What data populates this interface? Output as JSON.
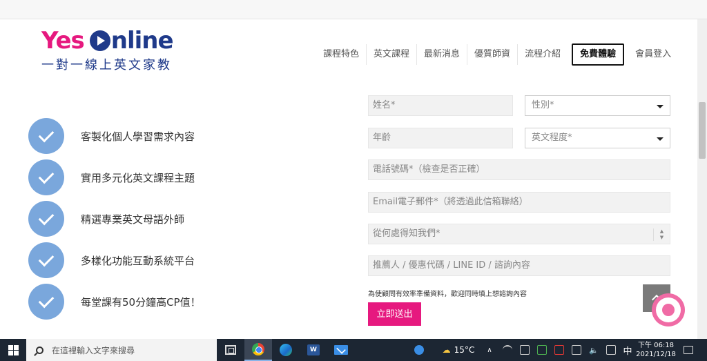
{
  "logo": {
    "brand_yes": "Yes",
    "brand_online": "nline",
    "subtitle": "一對一線上英文家教"
  },
  "nav": {
    "items": [
      {
        "label": "課程特色"
      },
      {
        "label": "英文課程"
      },
      {
        "label": "最新消息"
      },
      {
        "label": "優質師資"
      },
      {
        "label": "流程介紹"
      },
      {
        "label": "免費體驗"
      },
      {
        "label": "會員登入"
      }
    ]
  },
  "features": [
    "客製化個人學習需求內容",
    "實用多元化英文課程主題",
    "精選專業英文母語外師",
    "多樣化功能互動系統平台",
    "每堂課有50分鐘高CP值！"
  ],
  "form": {
    "name_placeholder": "姓名*",
    "gender_placeholder": "性別*",
    "age_placeholder": "年齡",
    "level_placeholder": "英文程度*",
    "phone_placeholder": "電話號碼*（檢查是否正確）",
    "email_placeholder": "Email電子郵件*（將透過此信箱聯絡）",
    "source_placeholder": "從何處得知我們*",
    "referral_placeholder": "推薦人 / 優惠代碼 / LINE ID / 諮詢內容",
    "note": "為使顧問有效率準備資料，歡迎同時填上想諮詢內容",
    "submit_label": "立即送出"
  },
  "taskbar": {
    "search_placeholder": "在這裡輸入文字來搜尋",
    "weather": "15°C",
    "ime": "中",
    "time": "下午 06:18",
    "date": "2021/12/18"
  },
  "colors": {
    "accent": "#e6197f",
    "brand_blue": "#1f3a8a",
    "check_blue": "#7aa7dc",
    "taskbar": "#1c2633"
  },
  "icons": [
    "check-circle-icon",
    "caret-down-icon",
    "up-arrow-icon",
    "chat-icon",
    "windows-icon",
    "search-icon",
    "chrome-icon",
    "edge-icon",
    "word-icon",
    "mail-icon"
  ]
}
